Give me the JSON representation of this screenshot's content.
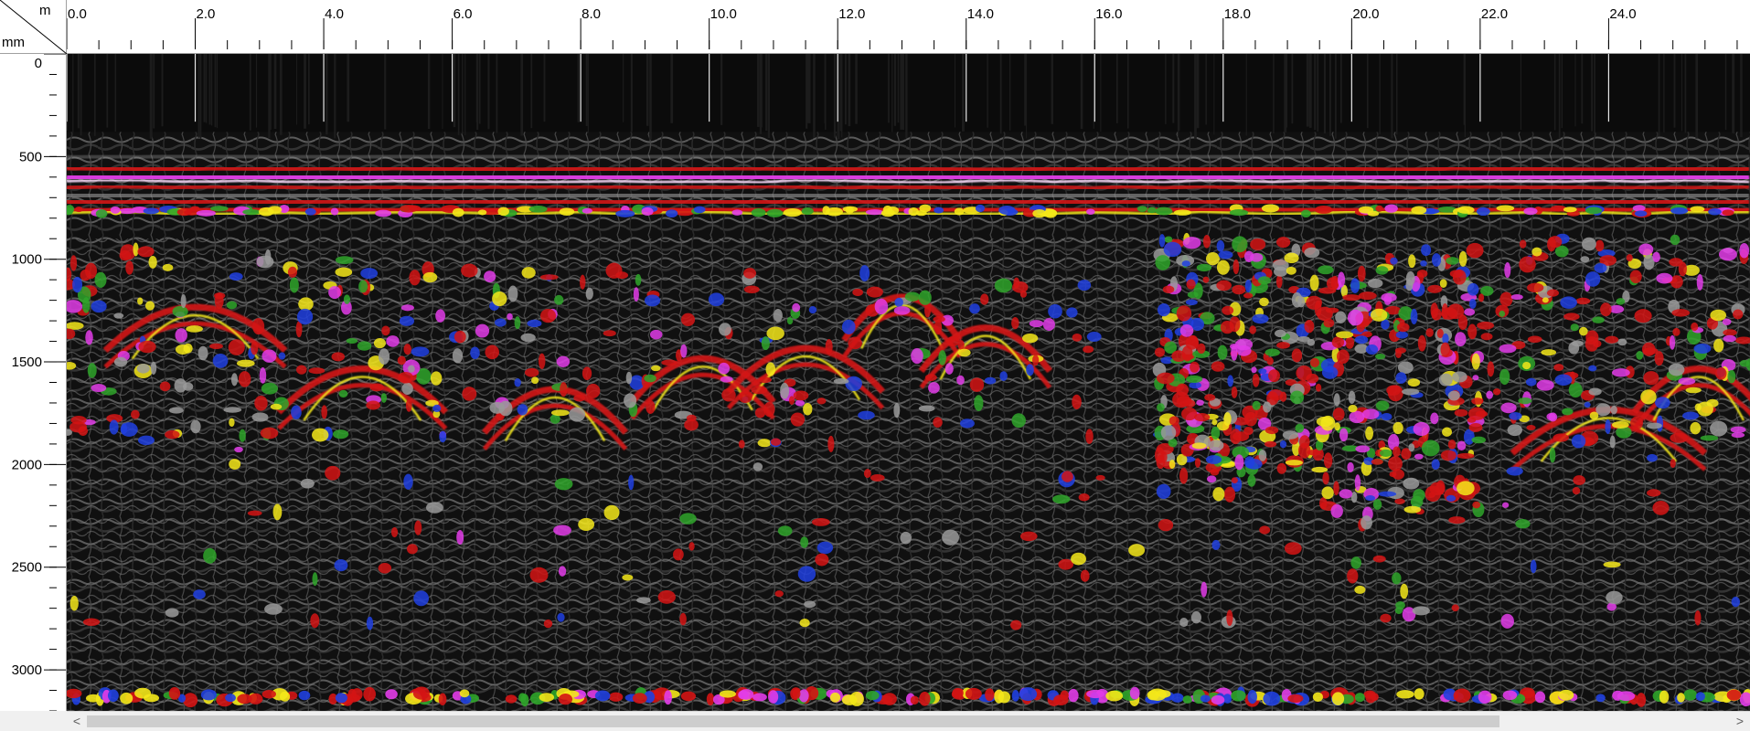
{
  "axes": {
    "horizontal_unit": "m",
    "vertical_unit": "mm",
    "x_ticks": [
      "0.0",
      "2.0",
      "4.0",
      "6.0",
      "8.0",
      "10.0",
      "12.0",
      "14.0",
      "16.0",
      "18.0",
      "20.0",
      "22.0",
      "24.0"
    ],
    "y_ticks": [
      "0",
      "500",
      "1000",
      "1500",
      "2000",
      "2500",
      "3000"
    ]
  },
  "scan": {
    "distance_range_m": [
      0,
      26.2
    ],
    "depth_range_mm": [
      0,
      3200
    ],
    "colormap": {
      "background": "#0b0b0b",
      "gray": "#9a9a9a",
      "red": "#d41414",
      "yellow": "#f4e81a",
      "green": "#2fa52a",
      "magenta": "#e23ce8",
      "blue": "#2040e0"
    }
  },
  "scrollbar": {
    "left_arrow_icon": "chevron-left-icon",
    "right_arrow_icon": "chevron-right-icon",
    "left_glyph": "<",
    "right_glyph": ">",
    "thumb_fraction": 0.86
  }
}
